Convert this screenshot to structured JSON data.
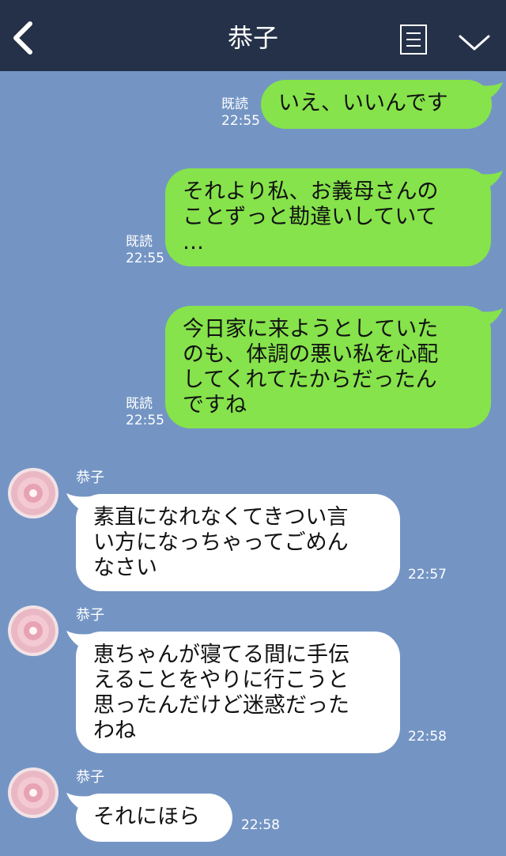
{
  "header": {
    "title": "恭子",
    "icons": [
      "back-icon",
      "menu-icon",
      "chevron-down-icon"
    ]
  },
  "colors": {
    "header_bg": "#243148",
    "chat_bg": "#7495c4",
    "sent_bubble": "#86e34b",
    "received_bubble": "#ffffff"
  },
  "messages": [
    {
      "side": "sent",
      "lines": [
        "いえ、いいんです"
      ],
      "read": "既読",
      "time": "22:55"
    },
    {
      "side": "sent",
      "lines": [
        "それより私、お義母さんの",
        "ことずっと勘違いしていて",
        "…"
      ],
      "read": "既読",
      "time": "22:55"
    },
    {
      "side": "sent",
      "lines": [
        "今日家に来ようとしていた",
        "のも、体調の悪い私を心配",
        "してくれてたからだったん",
        "ですね"
      ],
      "read": "既読",
      "time": "22:55"
    },
    {
      "side": "received",
      "sender": "恭子",
      "lines": [
        "素直になれなくてきつい言",
        "い方になっちゃってごめん",
        "なさい"
      ],
      "time": "22:57"
    },
    {
      "side": "received",
      "sender": "恭子",
      "lines": [
        "恵ちゃんが寝てる間に手伝",
        "えることをやりに行こうと",
        "思ったんだけど迷惑だった",
        "わね"
      ],
      "time": "22:58"
    },
    {
      "side": "received",
      "sender": "恭子",
      "lines": [
        "それにほら"
      ],
      "time": "22:58"
    }
  ]
}
